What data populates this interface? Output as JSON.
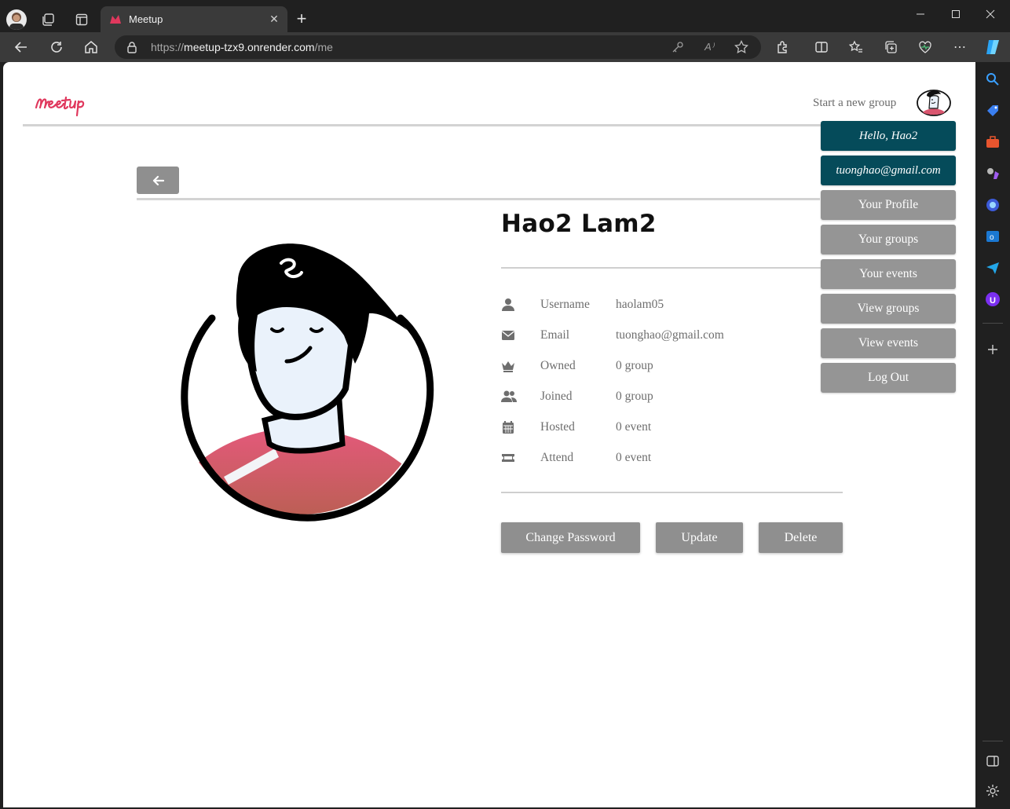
{
  "browser": {
    "tab_title": "Meetup",
    "tab_close": "✕",
    "new_tab": "+",
    "url_prefix": "https://",
    "url_host": "meetup-tzx9.onrender.com",
    "url_path": "/me"
  },
  "header": {
    "start_group": "Start a new group"
  },
  "profile": {
    "name": "Hao2 Lam2",
    "rows": [
      {
        "icon": "user-icon",
        "label": "Username",
        "value": "haolam05"
      },
      {
        "icon": "envelope-icon",
        "label": "Email",
        "value": "tuonghao@gmail.com"
      },
      {
        "icon": "crown-icon",
        "label": "Owned",
        "value": "0 group"
      },
      {
        "icon": "users-icon",
        "label": "Joined",
        "value": "0 group"
      },
      {
        "icon": "calendar-icon",
        "label": "Hosted",
        "value": "0 event"
      },
      {
        "icon": "ticket-icon",
        "label": "Attend",
        "value": "0 event"
      }
    ],
    "buttons": {
      "change_password": "Change Password",
      "update": "Update",
      "delete": "Delete"
    }
  },
  "menu": {
    "greeting": "Hello, Hao2",
    "email": "tuonghao@gmail.com",
    "items": [
      "Your Profile",
      "Your groups",
      "Your events",
      "View groups",
      "View events",
      "Log Out"
    ]
  },
  "colors": {
    "brand": "#e0385d",
    "menu_dark": "#054b5a",
    "button_gray": "#8f8f8f",
    "shirt": "#d9566f"
  }
}
